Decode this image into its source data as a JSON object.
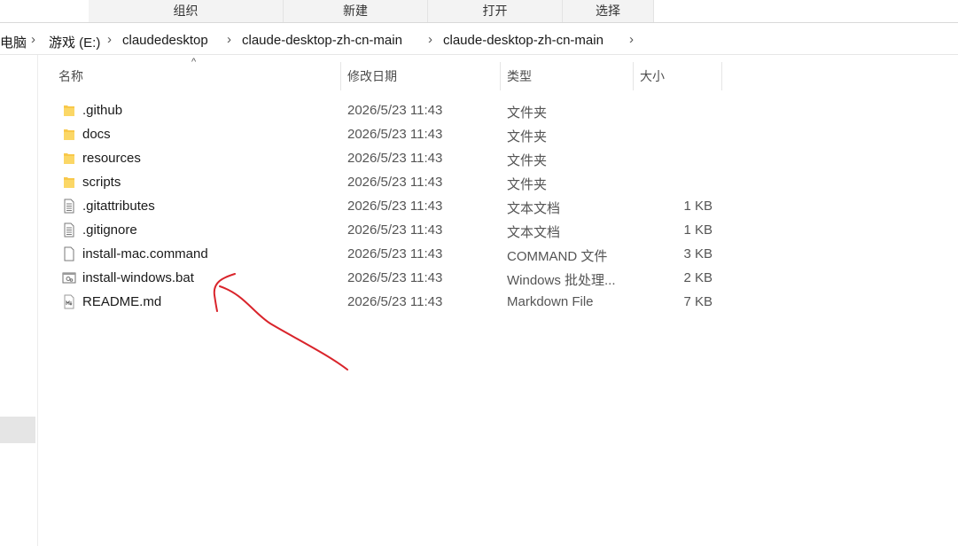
{
  "ribbon": {
    "groups": [
      "组织",
      "新建",
      "打开",
      "选择"
    ]
  },
  "breadcrumb": {
    "items": [
      "电脑",
      "游戏 (E:)",
      "claudedesktop",
      "claude-desktop-zh-cn-main",
      "claude-desktop-zh-cn-main"
    ]
  },
  "columns": {
    "name": "名称",
    "modified": "修改日期",
    "type": "类型",
    "size": "大小"
  },
  "files": [
    {
      "name": ".github",
      "modified": "2026/5/23 11:43",
      "type": "文件夹",
      "size": "",
      "icon": "folder-icon"
    },
    {
      "name": "docs",
      "modified": "2026/5/23 11:43",
      "type": "文件夹",
      "size": "",
      "icon": "folder-icon"
    },
    {
      "name": "resources",
      "modified": "2026/5/23 11:43",
      "type": "文件夹",
      "size": "",
      "icon": "folder-icon"
    },
    {
      "name": "scripts",
      "modified": "2026/5/23 11:43",
      "type": "文件夹",
      "size": "",
      "icon": "folder-icon"
    },
    {
      "name": ".gitattributes",
      "modified": "2026/5/23 11:43",
      "type": "文本文档",
      "size": "1 KB",
      "icon": "text-document-icon"
    },
    {
      "name": ".gitignore",
      "modified": "2026/5/23 11:43",
      "type": "文本文档",
      "size": "1 KB",
      "icon": "text-document-icon"
    },
    {
      "name": "install-mac.command",
      "modified": "2026/5/23 11:43",
      "type": "COMMAND 文件",
      "size": "3 KB",
      "icon": "blank-file-icon"
    },
    {
      "name": "install-windows.bat",
      "modified": "2026/5/23 11:43",
      "type": "Windows 批处理...",
      "size": "2 KB",
      "icon": "batch-file-icon"
    },
    {
      "name": "README.md",
      "modified": "2026/5/23 11:43",
      "type": "Markdown File",
      "size": "7 KB",
      "icon": "markdown-file-icon"
    }
  ],
  "colors": {
    "folder": "#f8c84a",
    "annotation": "#d9242b"
  }
}
